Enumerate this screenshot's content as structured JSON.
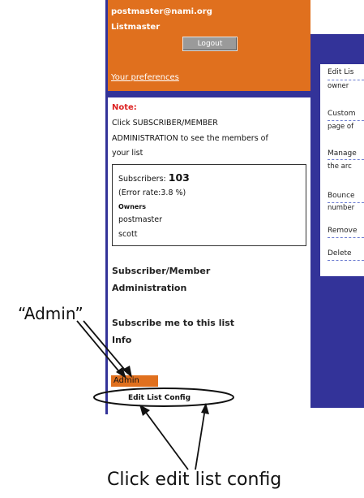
{
  "account": {
    "email": "postmaster@nami.org",
    "role": "Listmaster",
    "logout_label": "Logout",
    "preferences_label": "Your preferences"
  },
  "note": {
    "title": "Note:",
    "lines": [
      "Click SUBSCRIBER/MEMBER",
      "ADMINISTRATION to see the members of",
      "your list"
    ]
  },
  "stats": {
    "subscribers_label": "Subscribers:",
    "subscribers_count": "103",
    "error_rate": "(Error rate:3.8 %)",
    "owners_label": "Owners",
    "owners": [
      "postmaster",
      "scott"
    ]
  },
  "menu": {
    "subscriber_admin_1": "Subscriber/Member",
    "subscriber_admin_2": "Administration",
    "subscribe_me": "Subscribe me to this list",
    "info": "Info",
    "admin": "Admin",
    "edit_list_config": "Edit List Config"
  },
  "right_menu": [
    {
      "title": "Edit Lis",
      "desc": "owner"
    },
    {
      "title": "Custom",
      "desc": "page of"
    },
    {
      "title": "Manage",
      "desc": "the arc"
    },
    {
      "title": "Bounce",
      "desc": "number"
    },
    {
      "title": "Remove",
      "desc": ""
    },
    {
      "title": "Delete",
      "desc": ""
    }
  ],
  "annotations": {
    "admin_callout": "“Admin”",
    "click_callout": "Click edit list config"
  },
  "colors": {
    "orange": "#e0701e",
    "purple": "#333399",
    "note_red": "#dd2222"
  }
}
